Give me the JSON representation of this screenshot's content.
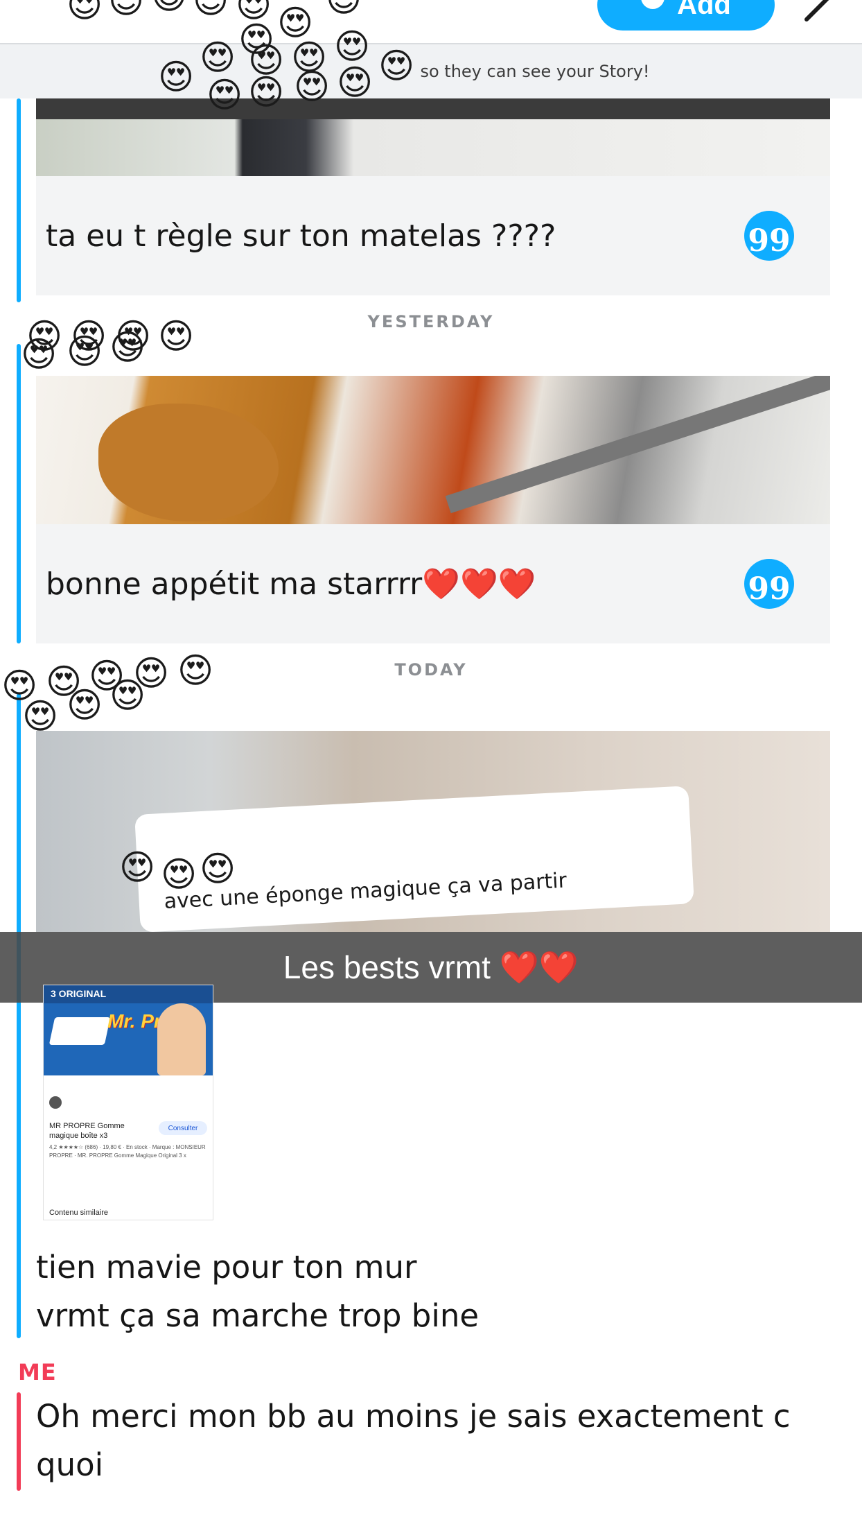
{
  "header": {
    "add_label": "Add",
    "notice": "so they can see your Story!"
  },
  "messages": {
    "reply1": {
      "text": "ta eu t règle sur ton matelas ????",
      "quote_glyph": "99"
    },
    "divider_yesterday": "YESTERDAY",
    "reply2": {
      "text": "bonne appétit ma starrrr❤️❤️❤️",
      "quote_glyph": "99"
    },
    "divider_today": "TODAY",
    "snap_caption": "avec une éponge magique ça va partir",
    "overlay_caption": "Les bests vrmt ❤️❤️",
    "product": {
      "band": "3 ORIGINAL",
      "brand": "Mr. Propre",
      "title": "MR PROPRE Gomme magique boîte x3",
      "consult": "Consulter",
      "meta": "4,2 ★★★★☆ (686) · 19,80 € · En stock · Marque : MONSIEUR PROPRE · MR. PROPRE Gomme Magique Original 3 x",
      "similar": "Contenu similaire"
    },
    "text_line1": "tien mavie pour ton mur",
    "text_line2": "vrmt ça sa marche trop bine",
    "me_label": "ME",
    "me_line1": "Oh merci mon bb au moins je sais exactement c",
    "me_line2": "quoi"
  },
  "emoji": {
    "heart_eyes": "😍",
    "heart": "❤️"
  },
  "colors": {
    "accent_blue": "#0fadff",
    "me_red": "#f23c57",
    "divider_gray": "#8c8f93"
  }
}
